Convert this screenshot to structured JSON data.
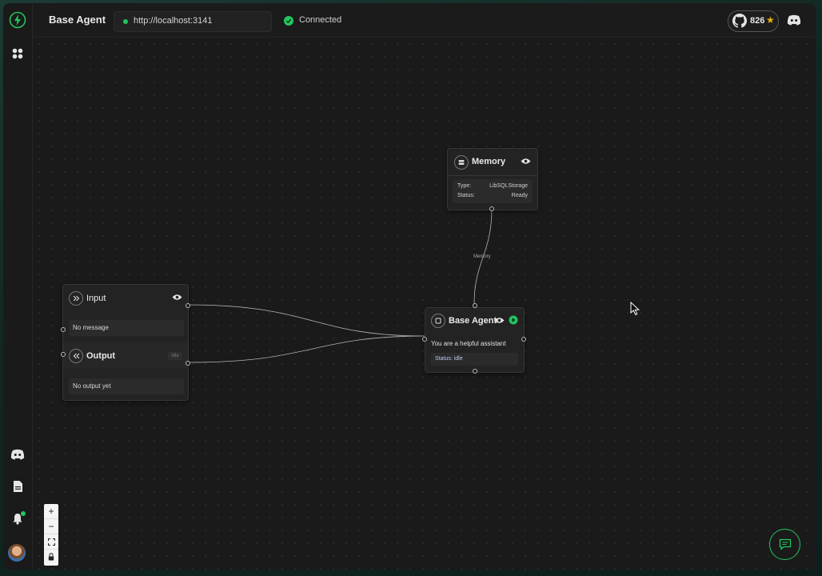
{
  "header": {
    "title": "Base Agent",
    "url": "http://localhost:3141",
    "connection_status": "Connected",
    "github_stars": "826"
  },
  "sidebar": {
    "items": [
      {
        "name": "logo",
        "icon": "bolt-icon"
      },
      {
        "name": "agents",
        "icon": "grid-icon"
      },
      {
        "name": "discord",
        "icon": "discord-icon"
      },
      {
        "name": "docs",
        "icon": "document-icon"
      },
      {
        "name": "notifications",
        "icon": "bell-icon"
      },
      {
        "name": "profile",
        "icon": "avatar"
      }
    ]
  },
  "nodes": {
    "memory": {
      "title": "Memory",
      "type_label": "Type:",
      "type_value": "LibSQLStorage",
      "status_label": "Status:",
      "status_value": "Ready"
    },
    "input": {
      "title": "Input",
      "message": "No message"
    },
    "output": {
      "title": "Output",
      "badge": "idle",
      "message": "No output yet"
    },
    "agent": {
      "title": "Base Agent",
      "description": "You are a helpful assistant",
      "status": "Status: idle"
    }
  },
  "edges": {
    "memory_label": "Memory"
  },
  "zoom_controls": {
    "zoom_in": "+",
    "zoom_out": "−"
  },
  "colors": {
    "accent": "#22c55e",
    "star": "#eab308",
    "background": "#191919"
  }
}
